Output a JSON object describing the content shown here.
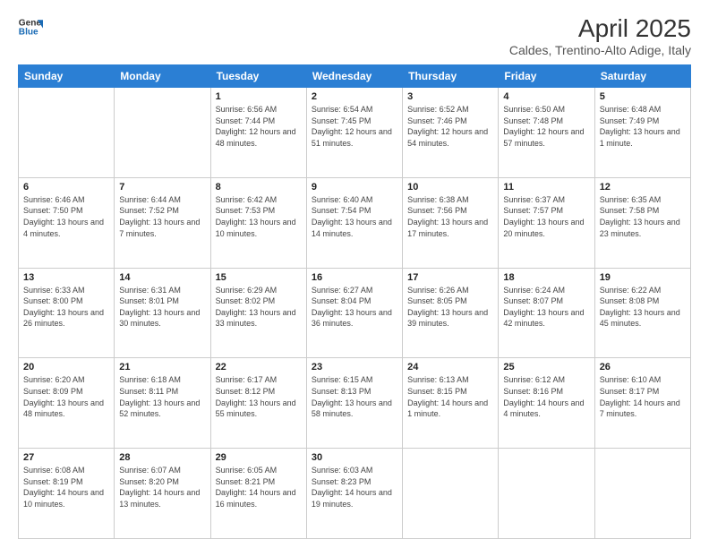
{
  "header": {
    "logo_line1": "General",
    "logo_line2": "Blue",
    "title": "April 2025",
    "subtitle": "Caldes, Trentino-Alto Adige, Italy"
  },
  "weekdays": [
    "Sunday",
    "Monday",
    "Tuesday",
    "Wednesday",
    "Thursday",
    "Friday",
    "Saturday"
  ],
  "weeks": [
    [
      {
        "day": "",
        "info": ""
      },
      {
        "day": "",
        "info": ""
      },
      {
        "day": "1",
        "info": "Sunrise: 6:56 AM\nSunset: 7:44 PM\nDaylight: 12 hours and 48 minutes."
      },
      {
        "day": "2",
        "info": "Sunrise: 6:54 AM\nSunset: 7:45 PM\nDaylight: 12 hours and 51 minutes."
      },
      {
        "day": "3",
        "info": "Sunrise: 6:52 AM\nSunset: 7:46 PM\nDaylight: 12 hours and 54 minutes."
      },
      {
        "day": "4",
        "info": "Sunrise: 6:50 AM\nSunset: 7:48 PM\nDaylight: 12 hours and 57 minutes."
      },
      {
        "day": "5",
        "info": "Sunrise: 6:48 AM\nSunset: 7:49 PM\nDaylight: 13 hours and 1 minute."
      }
    ],
    [
      {
        "day": "6",
        "info": "Sunrise: 6:46 AM\nSunset: 7:50 PM\nDaylight: 13 hours and 4 minutes."
      },
      {
        "day": "7",
        "info": "Sunrise: 6:44 AM\nSunset: 7:52 PM\nDaylight: 13 hours and 7 minutes."
      },
      {
        "day": "8",
        "info": "Sunrise: 6:42 AM\nSunset: 7:53 PM\nDaylight: 13 hours and 10 minutes."
      },
      {
        "day": "9",
        "info": "Sunrise: 6:40 AM\nSunset: 7:54 PM\nDaylight: 13 hours and 14 minutes."
      },
      {
        "day": "10",
        "info": "Sunrise: 6:38 AM\nSunset: 7:56 PM\nDaylight: 13 hours and 17 minutes."
      },
      {
        "day": "11",
        "info": "Sunrise: 6:37 AM\nSunset: 7:57 PM\nDaylight: 13 hours and 20 minutes."
      },
      {
        "day": "12",
        "info": "Sunrise: 6:35 AM\nSunset: 7:58 PM\nDaylight: 13 hours and 23 minutes."
      }
    ],
    [
      {
        "day": "13",
        "info": "Sunrise: 6:33 AM\nSunset: 8:00 PM\nDaylight: 13 hours and 26 minutes."
      },
      {
        "day": "14",
        "info": "Sunrise: 6:31 AM\nSunset: 8:01 PM\nDaylight: 13 hours and 30 minutes."
      },
      {
        "day": "15",
        "info": "Sunrise: 6:29 AM\nSunset: 8:02 PM\nDaylight: 13 hours and 33 minutes."
      },
      {
        "day": "16",
        "info": "Sunrise: 6:27 AM\nSunset: 8:04 PM\nDaylight: 13 hours and 36 minutes."
      },
      {
        "day": "17",
        "info": "Sunrise: 6:26 AM\nSunset: 8:05 PM\nDaylight: 13 hours and 39 minutes."
      },
      {
        "day": "18",
        "info": "Sunrise: 6:24 AM\nSunset: 8:07 PM\nDaylight: 13 hours and 42 minutes."
      },
      {
        "day": "19",
        "info": "Sunrise: 6:22 AM\nSunset: 8:08 PM\nDaylight: 13 hours and 45 minutes."
      }
    ],
    [
      {
        "day": "20",
        "info": "Sunrise: 6:20 AM\nSunset: 8:09 PM\nDaylight: 13 hours and 48 minutes."
      },
      {
        "day": "21",
        "info": "Sunrise: 6:18 AM\nSunset: 8:11 PM\nDaylight: 13 hours and 52 minutes."
      },
      {
        "day": "22",
        "info": "Sunrise: 6:17 AM\nSunset: 8:12 PM\nDaylight: 13 hours and 55 minutes."
      },
      {
        "day": "23",
        "info": "Sunrise: 6:15 AM\nSunset: 8:13 PM\nDaylight: 13 hours and 58 minutes."
      },
      {
        "day": "24",
        "info": "Sunrise: 6:13 AM\nSunset: 8:15 PM\nDaylight: 14 hours and 1 minute."
      },
      {
        "day": "25",
        "info": "Sunrise: 6:12 AM\nSunset: 8:16 PM\nDaylight: 14 hours and 4 minutes."
      },
      {
        "day": "26",
        "info": "Sunrise: 6:10 AM\nSunset: 8:17 PM\nDaylight: 14 hours and 7 minutes."
      }
    ],
    [
      {
        "day": "27",
        "info": "Sunrise: 6:08 AM\nSunset: 8:19 PM\nDaylight: 14 hours and 10 minutes."
      },
      {
        "day": "28",
        "info": "Sunrise: 6:07 AM\nSunset: 8:20 PM\nDaylight: 14 hours and 13 minutes."
      },
      {
        "day": "29",
        "info": "Sunrise: 6:05 AM\nSunset: 8:21 PM\nDaylight: 14 hours and 16 minutes."
      },
      {
        "day": "30",
        "info": "Sunrise: 6:03 AM\nSunset: 8:23 PM\nDaylight: 14 hours and 19 minutes."
      },
      {
        "day": "",
        "info": ""
      },
      {
        "day": "",
        "info": ""
      },
      {
        "day": "",
        "info": ""
      }
    ]
  ]
}
